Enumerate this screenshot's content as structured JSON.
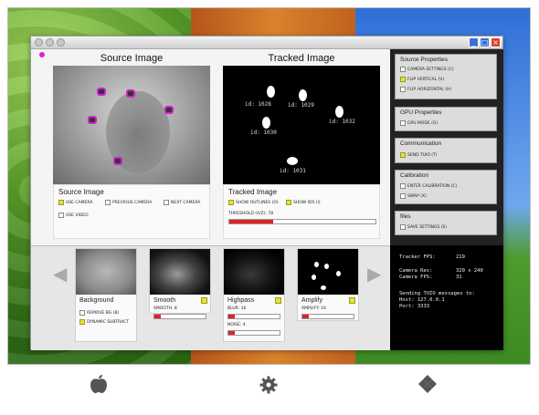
{
  "main": {
    "source_title": "Source Image",
    "tracked_title": "Tracked Image",
    "source_panel": {
      "heading": "Source Image",
      "options": [
        {
          "label": "USE CAMERA",
          "checked": true
        },
        {
          "label": "PREVIOUS CAMERA",
          "checked": false
        },
        {
          "label": "NEXT CAMERA",
          "checked": false
        },
        {
          "label": "USE VIDEO",
          "checked": false
        }
      ]
    },
    "tracked_panel": {
      "heading": "Tracked Image",
      "options": [
        {
          "label": "SHOW OUTLINES (O)",
          "checked": true
        },
        {
          "label": "SHOW IDS (I)",
          "checked": true
        }
      ],
      "threshold_label": "THRESHOLD (A/Z): 78",
      "threshold_fraction": 0.3
    },
    "blob_ids": [
      "id: 1028",
      "id: 1029",
      "id: 1030",
      "id: 1032",
      "id: 1031"
    ]
  },
  "filters": [
    {
      "name": "Background",
      "options": [
        {
          "label": "REMOVE BG (B)",
          "checked": false
        },
        {
          "label": "DYNAMIC SUBTRACT",
          "checked": true
        }
      ]
    },
    {
      "name": "Smooth",
      "sliders": [
        {
          "label": "SMOOTH: 8",
          "fraction": 0.12
        }
      ]
    },
    {
      "name": "Highpass",
      "sliders": [
        {
          "label": "BLUR: 16",
          "fraction": 0.12
        },
        {
          "label": "NOISE: 4",
          "fraction": 0.12
        }
      ]
    },
    {
      "name": "Amplify",
      "sliders": [
        {
          "label": "AMPLIFY: 16",
          "fraction": 0.12
        }
      ]
    }
  ],
  "sidebar": {
    "groups": [
      {
        "heading": "Source Properties",
        "options": [
          {
            "label": "CAMERA SETTINGS (C)",
            "checked": false
          },
          {
            "label": "FLIP VERTICAL (V)",
            "checked": true
          },
          {
            "label": "FLIP HORIZONTAL (H)",
            "checked": false
          }
        ]
      },
      {
        "heading": "GPU Properties",
        "options": [
          {
            "label": "GPU MODE (G)",
            "checked": false
          }
        ]
      },
      {
        "heading": "Communication",
        "options": [
          {
            "label": "SEND TUIO (T)",
            "checked": true
          }
        ]
      },
      {
        "heading": "Calibration",
        "options": [
          {
            "label": "ENTER CALIBRATION (C)",
            "checked": false
          },
          {
            "label": "SWAP (X)",
            "checked": false
          }
        ]
      },
      {
        "heading": "files",
        "options": [
          {
            "label": "SAVE SETTINGS (S)",
            "checked": false
          }
        ]
      }
    ]
  },
  "stats": {
    "fps_label": "Tracker FPS:",
    "fps_value": "219",
    "res_label": "Camera Res:",
    "res_value": "320 x 240",
    "cam_fps_label": "Camera FPS:",
    "cam_fps_value": "31",
    "sending": "Sending TUIO messages to:",
    "host": "Host:  127.0.0.1",
    "port": "Port:  3333"
  },
  "dock": {
    "icons": [
      "apple-icon",
      "gear-icon",
      "windows-icon"
    ]
  }
}
